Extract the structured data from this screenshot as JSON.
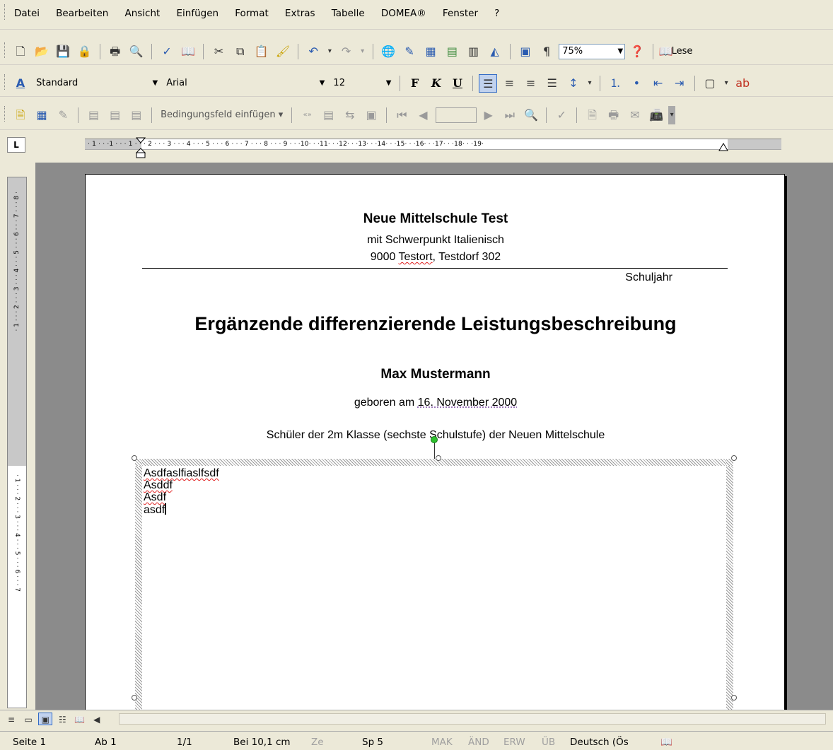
{
  "menu": [
    "Datei",
    "Bearbeiten",
    "Ansicht",
    "Einfügen",
    "Format",
    "Extras",
    "Tabelle",
    "DOMEA®",
    "Fenster",
    "?"
  ],
  "toolbar": {
    "zoom": "75%",
    "read_label": "Lese"
  },
  "format_bar": {
    "style": "Standard",
    "font": "Arial",
    "size": "12",
    "bold": "F",
    "italic": "K",
    "underline": "U"
  },
  "extra_bar": {
    "field_insert": "Bedingungsfeld einfügen"
  },
  "ruler": {
    "h_ticks": "· 1 · · ·1 · · · 1 · · · 2 · · · 3 · · · 4 · · · 5 · · · 6 · · · 7 · · · 8 · · · 9 · · ·10· · ·11· · ·12· · ·13· · ·14· · ·15· · ·16· · ·17· · ·18· · ·19·",
    "v_ticks_top": "· 1 · · · 2 · · · 3 · · · 4 · · · 5 · · · 6 · · · 7 · · · 8 ·",
    "v_ticks_bottom": "· 1 · · · 2 · · · 3 · · · 4 · · · 5 · · · 6 · · · 7"
  },
  "document": {
    "school_name": "Neue Mittelschule Test",
    "school_sub": "mit Schwerpunkt Italienisch",
    "addr_prefix": "9000 ",
    "addr_town": "Testort",
    "addr_suffix": ", Testdorf 302",
    "schuljahr": "Schuljahr",
    "title": "Ergänzende differenzierende Leistungsbeschreibung",
    "student": "Max Mustermann",
    "birth_prefix": "geboren am ",
    "birth_date": "16. November 2000",
    "class_line": "Schüler der 2m Klasse (sechste Schulstufe) der Neuen Mittelschule",
    "textbox_lines": [
      "Asdfaslfiaslfsdf",
      "Asddf",
      "Asdf",
      "asdf"
    ]
  },
  "status": {
    "page": "Seite 1",
    "section": "Ab 1",
    "pages": "1/1",
    "pos": "Bei 10,1 cm",
    "line": "Ze",
    "col": "Sp 5",
    "mak": "MAK",
    "aend": "ÄND",
    "erw": "ERW",
    "ueb": "ÜB",
    "lang": "Deutsch (Ös"
  }
}
